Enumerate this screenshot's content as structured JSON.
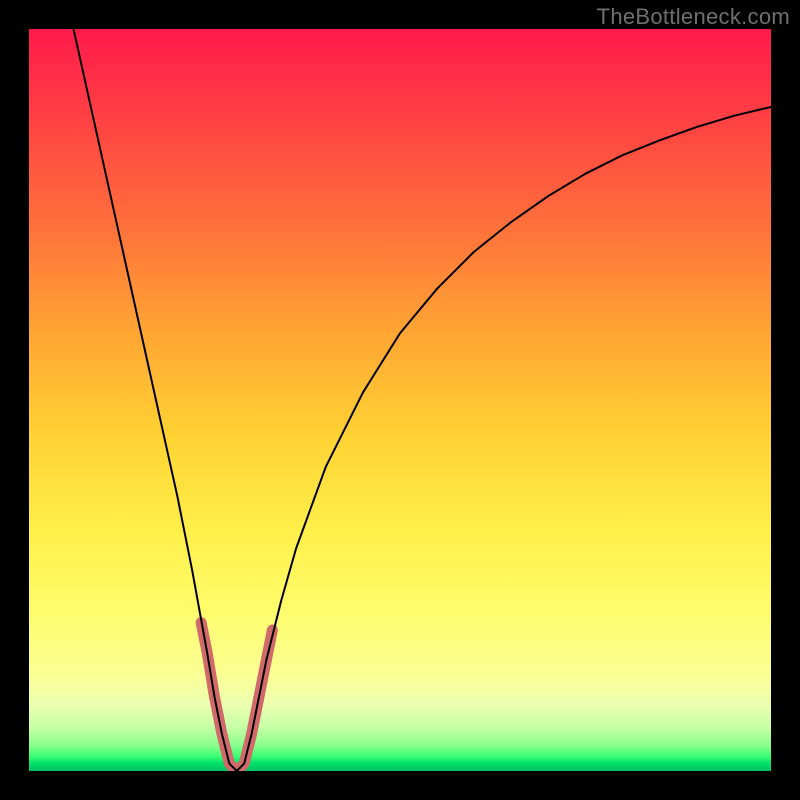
{
  "watermark": "TheBottleneck.com",
  "chart_data": {
    "type": "line",
    "title": "",
    "xlabel": "",
    "ylabel": "",
    "xlim": [
      0,
      100
    ],
    "ylim": [
      0,
      100
    ],
    "grid": false,
    "series": [
      {
        "name": "curve",
        "stroke": "#000000",
        "stroke_width": 2,
        "x": [
          6,
          8,
          10,
          12,
          14,
          16,
          18,
          20,
          22,
          24,
          25,
          26,
          27,
          28,
          29,
          30,
          31,
          32,
          34,
          36,
          40,
          45,
          50,
          55,
          60,
          65,
          70,
          75,
          80,
          85,
          90,
          95,
          100
        ],
        "y": [
          100,
          91,
          82,
          73,
          64,
          55,
          46,
          37,
          27,
          16,
          10,
          5,
          1,
          0,
          1,
          5,
          10,
          15,
          23,
          30,
          41,
          51,
          59,
          65,
          70,
          74,
          77.5,
          80.5,
          83,
          85,
          86.8,
          88.3,
          89.5
        ]
      },
      {
        "name": "highlight",
        "stroke": "#d16a6a",
        "stroke_width": 11,
        "linecap": "round",
        "x": [
          23.2,
          24,
          25,
          26,
          27,
          28,
          29,
          30,
          31,
          32,
          32.8
        ],
        "y": [
          20,
          16,
          10,
          5,
          1,
          0,
          1,
          5,
          10,
          15,
          19
        ]
      }
    ],
    "background_gradient": {
      "direction": "vertical",
      "stops": [
        {
          "pos": 0.0,
          "color": "#ff1a4b"
        },
        {
          "pos": 0.25,
          "color": "#ff6b3c"
        },
        {
          "pos": 0.55,
          "color": "#ffd333"
        },
        {
          "pos": 0.78,
          "color": "#fffc6a"
        },
        {
          "pos": 0.94,
          "color": "#c8ffa8"
        },
        {
          "pos": 1.0,
          "color": "#00c060"
        }
      ]
    }
  }
}
